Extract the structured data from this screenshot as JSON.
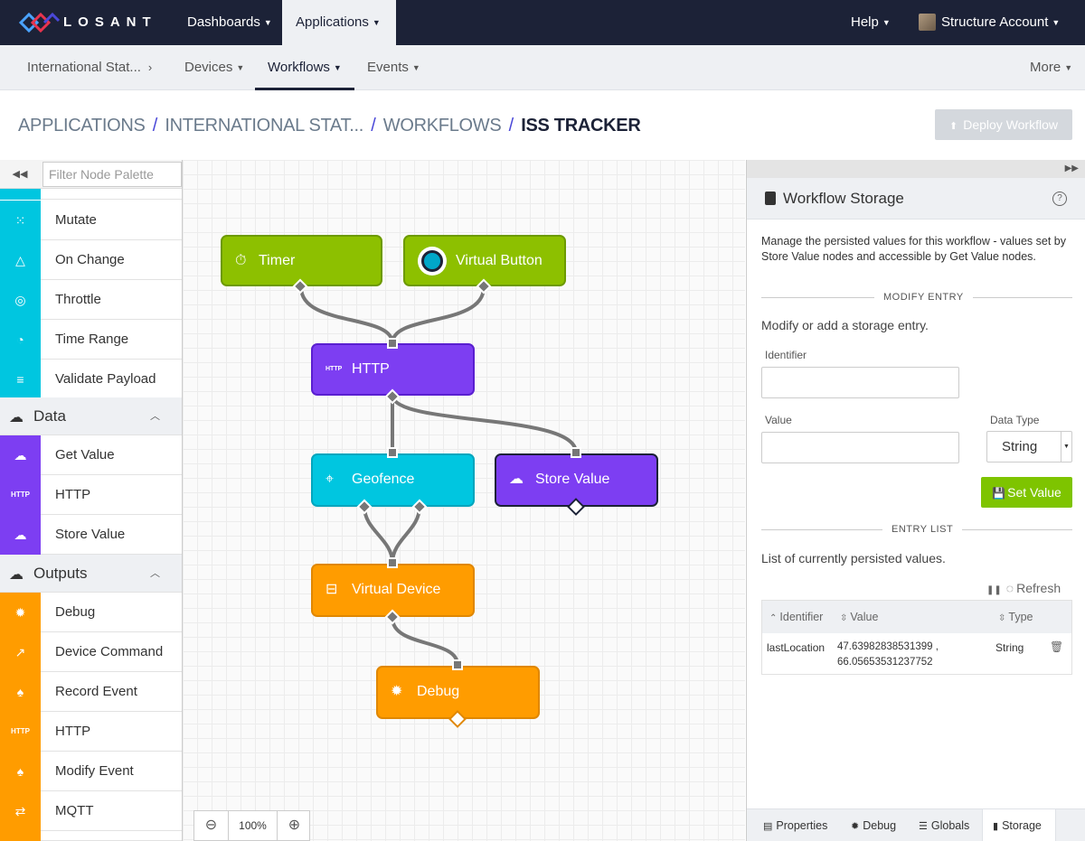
{
  "topnav": {
    "brand": "LOSANT",
    "items": [
      "Dashboards",
      "Applications"
    ],
    "help": "Help",
    "account": "Structure Account"
  },
  "subnav": {
    "app": "International Stat...",
    "items": [
      "Devices",
      "Workflows",
      "Events"
    ],
    "more": "More"
  },
  "breadcrumb": {
    "parts": [
      "APPLICATIONS",
      "INTERNATIONAL STAT...",
      "WORKFLOWS"
    ],
    "current": "ISS TRACKER",
    "separator": "/"
  },
  "deploy_label": "Deploy Workflow",
  "palette": {
    "filter_placeholder": "Filter Node Palette",
    "logic_items": [
      "Mutate",
      "On Change",
      "Throttle",
      "Time Range",
      "Validate Payload"
    ],
    "data_category": "Data",
    "data_items": [
      "Get Value",
      "HTTP",
      "Store Value"
    ],
    "outputs_category": "Outputs",
    "output_items": [
      "Debug",
      "Device Command",
      "Record Event",
      "HTTP",
      "Modify Event",
      "MQTT"
    ],
    "http_badge": "HTTP"
  },
  "canvas": {
    "nodes": {
      "timer": "Timer",
      "virtual_button": "Virtual Button",
      "http": "HTTP",
      "geofence": "Geofence",
      "store_value": "Store Value",
      "virtual_device": "Virtual Device",
      "debug": "Debug"
    },
    "http_badge": "HTTP",
    "zoom": "100%"
  },
  "storage_panel": {
    "title": "Workflow Storage",
    "description": "Manage the persisted values for this workflow - values set by Store Value nodes and accessible by Get Value nodes.",
    "modify_heading": "MODIFY ENTRY",
    "modify_text": "Modify or add a storage entry.",
    "identifier_label": "Identifier",
    "value_label": "Value",
    "data_type_label": "Data Type",
    "data_type_value": "String",
    "set_value_label": "Set Value",
    "entry_list_heading": "ENTRY LIST",
    "entry_list_text": "List of currently persisted values.",
    "refresh_label": "Refresh",
    "table_headers": [
      "Identifier",
      "Value",
      "Type"
    ],
    "rows": [
      {
        "identifier": "lastLocation",
        "value_line1": "47.63982838531399 ,",
        "value_line2": "66.05653531237752",
        "type": "String"
      }
    ]
  },
  "bottom_tabs": [
    "Properties",
    "Debug",
    "Globals",
    "Storage"
  ],
  "colors": {
    "nav": "#1c2237",
    "green_node": "#8dc000",
    "purple_node": "#7d3ef2",
    "teal_node": "#00c6e0",
    "orange_node": "#ff9c00",
    "set_value_button": "#7ec400"
  }
}
